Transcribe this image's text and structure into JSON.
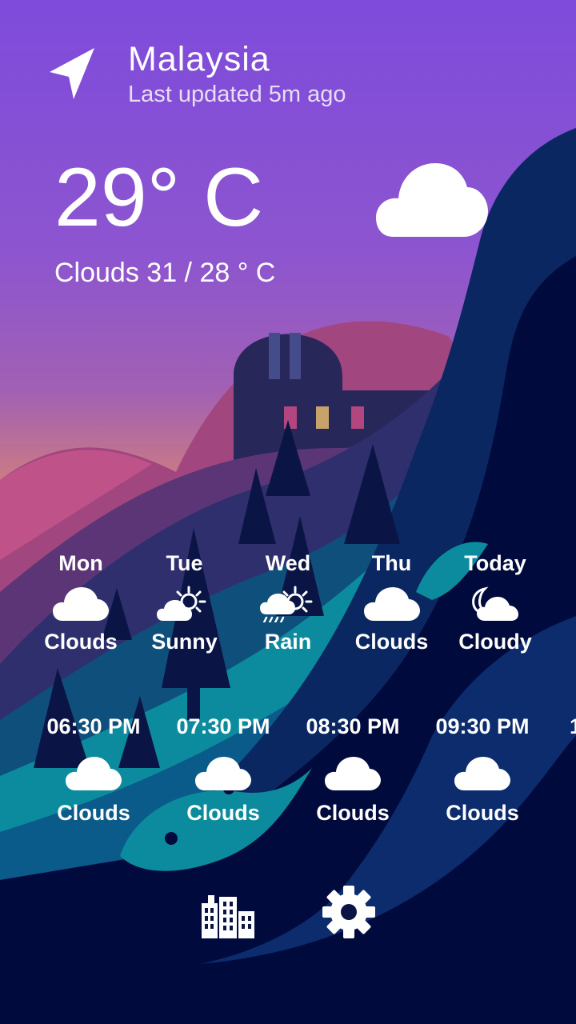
{
  "location": {
    "name": "Malaysia",
    "updated": "Last updated 5m ago"
  },
  "current": {
    "temp": "29° C",
    "desc": "Clouds 31 / 28 ° C",
    "icon": "cloud-icon"
  },
  "daily": [
    {
      "day": "Mon",
      "cond": "Clouds",
      "icon": "cloud-icon"
    },
    {
      "day": "Tue",
      "cond": "Sunny",
      "icon": "sun-cloud-icon"
    },
    {
      "day": "Wed",
      "cond": "Rain",
      "icon": "rain-sun-icon"
    },
    {
      "day": "Thu",
      "cond": "Clouds",
      "icon": "cloud-icon"
    },
    {
      "day": "Today",
      "cond": "Cloudy",
      "icon": "moon-cloud-icon"
    }
  ],
  "hourly": [
    {
      "time": "06:30 PM",
      "cond": "Clouds",
      "icon": "cloud-icon"
    },
    {
      "time": "07:30 PM",
      "cond": "Clouds",
      "icon": "cloud-icon"
    },
    {
      "time": "08:30 PM",
      "cond": "Clouds",
      "icon": "cloud-icon"
    },
    {
      "time": "09:30 PM",
      "cond": "Clouds",
      "icon": "cloud-icon"
    },
    {
      "time": "1",
      "cond": "",
      "icon": ""
    }
  ],
  "nav": {
    "cities_icon": "city-buildings-icon",
    "settings_icon": "gear-icon"
  }
}
